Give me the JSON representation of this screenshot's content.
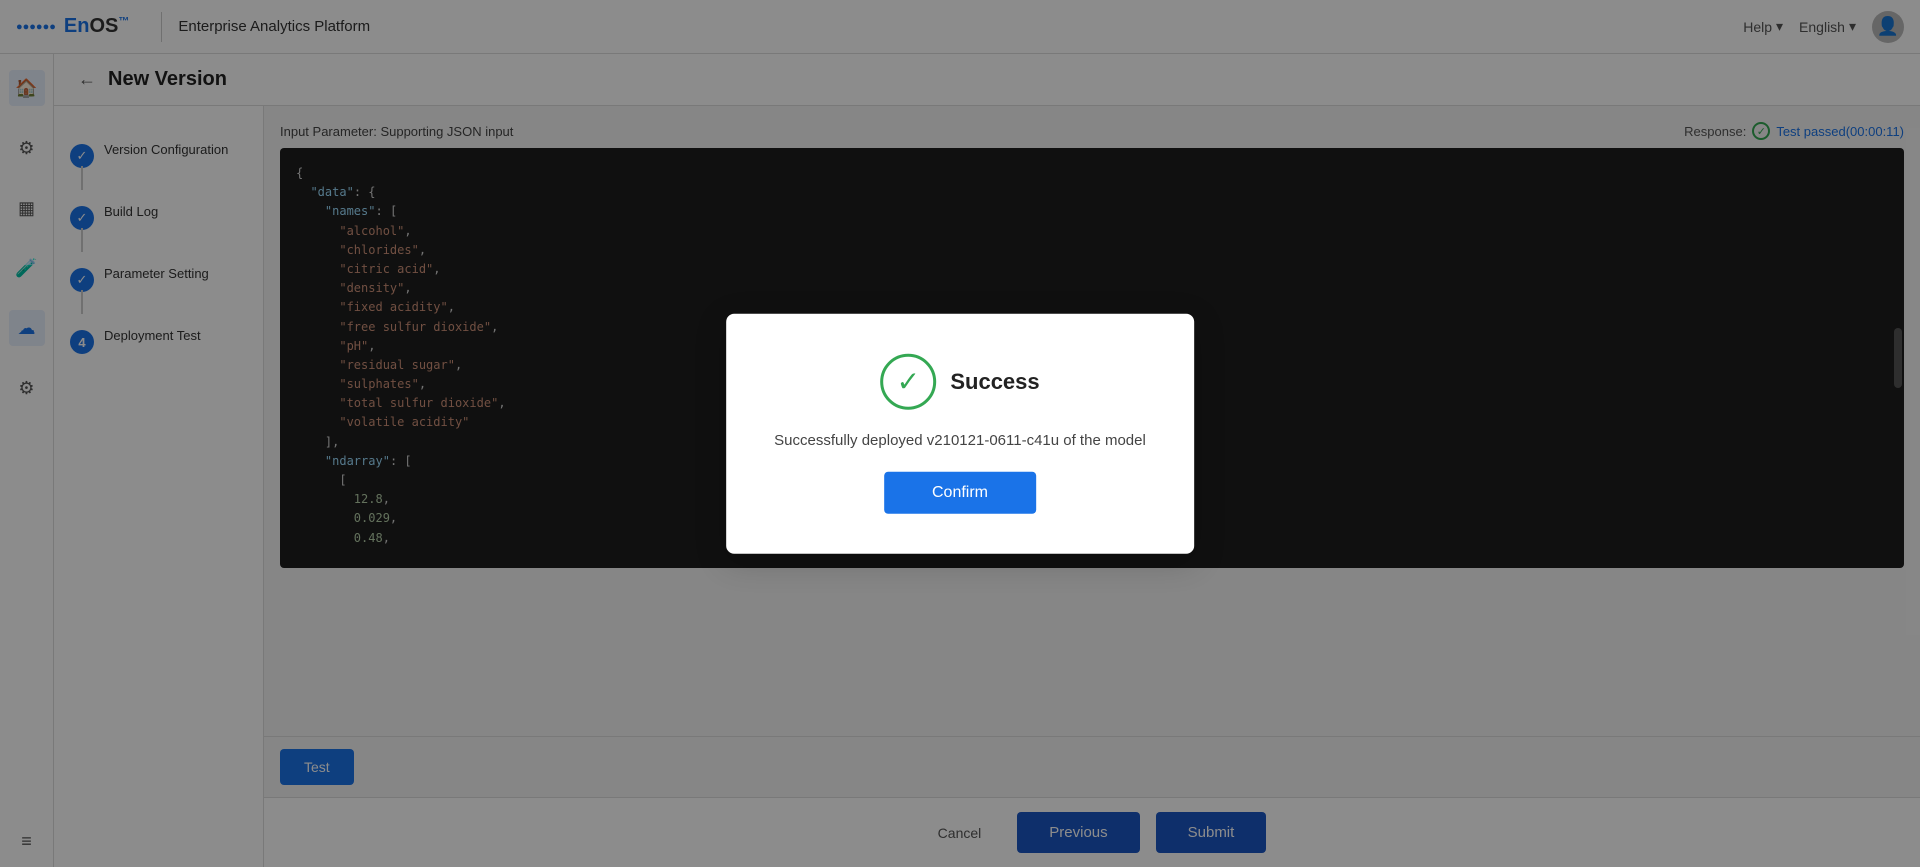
{
  "topNav": {
    "logoText": "EnOS™",
    "platformTitle": "Enterprise Analytics Platform",
    "helpLabel": "Help",
    "langLabel": "English"
  },
  "pageHeader": {
    "title": "New Version"
  },
  "steps": [
    {
      "id": 1,
      "label": "Version Configuration",
      "status": "check"
    },
    {
      "id": 2,
      "label": "Build Log",
      "status": "check"
    },
    {
      "id": 3,
      "label": "Parameter Setting",
      "status": "check"
    },
    {
      "id": 4,
      "label": "Deployment Test",
      "status": "num"
    }
  ],
  "editor": {
    "inputLabel": "Input Parameter: Supporting JSON input",
    "responseLabel": "Response:",
    "responseStatus": "Test passed(00:00:11)",
    "codeContent": "{\n  \"data\": {\n    \"names\": [\n      \"alcohol\",\n      \"chlorides\",\n      \"citric acid\",\n      \"density\",\n      \"fixed acidity\",\n      \"free sulfur dioxide\",\n      \"pH\",\n      \"residual sugar\",\n      \"sulphates\",\n      \"total sulfur dioxide\",\n      \"volatile acidity\"\n    ],\n    \"ndarray\": [\n      [\n        12.8,\n        0.029,\n        0.48,"
  },
  "buttons": {
    "testLabel": "Test",
    "cancelLabel": "Cancel",
    "previousLabel": "Previous",
    "submitLabel": "Submit"
  },
  "modal": {
    "title": "Success",
    "body": "Successfully deployed v210121-0611-c41u of the model",
    "confirmLabel": "Confirm"
  }
}
